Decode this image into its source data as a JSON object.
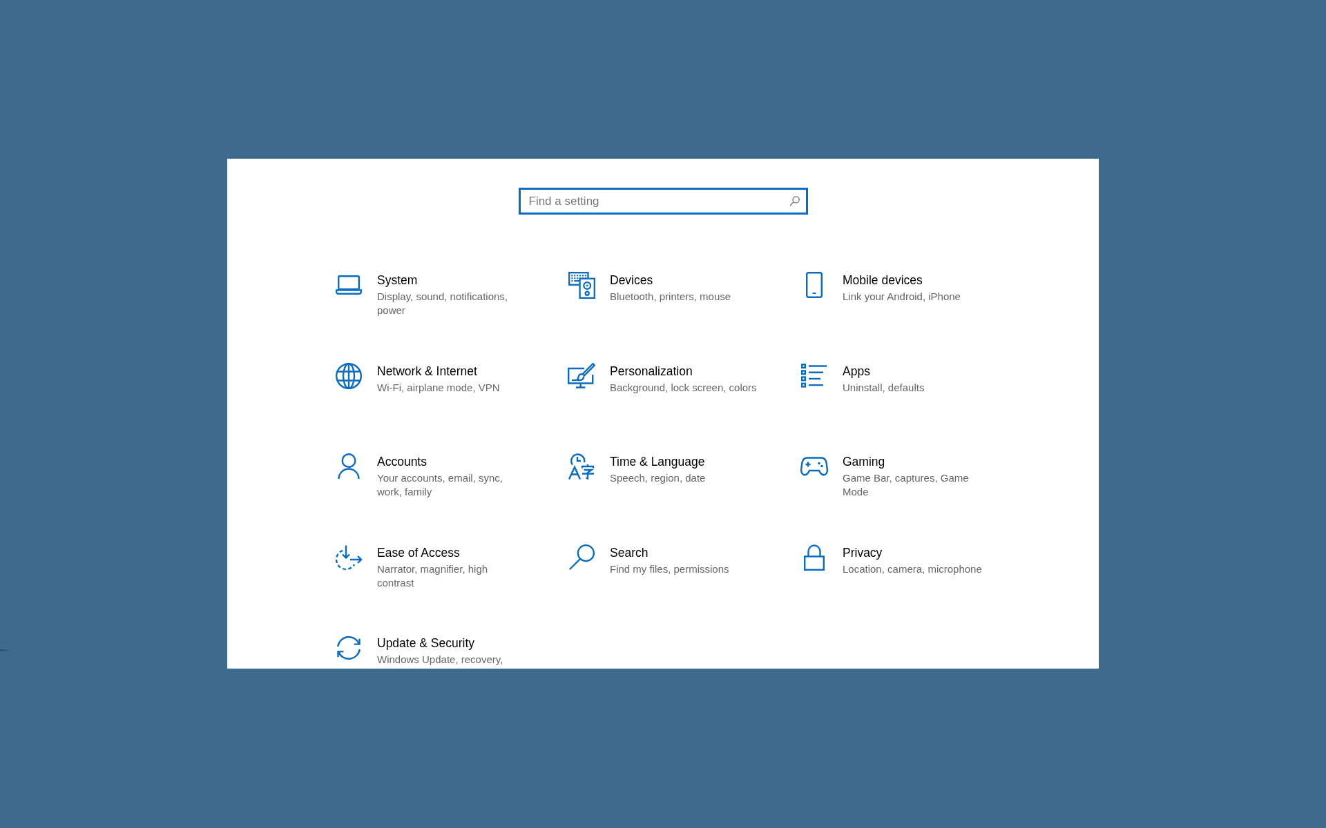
{
  "search": {
    "placeholder": "Find a setting"
  },
  "categories": [
    {
      "kind": "laptop",
      "title": "System",
      "description": "Display, sound, notifications, power"
    },
    {
      "kind": "devices",
      "title": "Devices",
      "description": "Bluetooth, printers, mouse"
    },
    {
      "kind": "phone",
      "title": "Mobile devices",
      "description": "Link your Android, iPhone"
    },
    {
      "kind": "globe",
      "title": "Network & Internet",
      "description": "Wi-Fi, airplane mode, VPN"
    },
    {
      "kind": "brush",
      "title": "Personalization",
      "description": "Background, lock screen, colors"
    },
    {
      "kind": "list",
      "title": "Apps",
      "description": "Uninstall, defaults"
    },
    {
      "kind": "person",
      "title": "Accounts",
      "description": "Your accounts, email, sync, work, family"
    },
    {
      "kind": "clock",
      "title": "Time & Language",
      "description": "Speech, region, date"
    },
    {
      "kind": "gamepad",
      "title": "Gaming",
      "description": "Game Bar, captures, Game Mode"
    },
    {
      "kind": "access",
      "title": "Ease of Access",
      "description": "Narrator, magnifier, high contrast"
    },
    {
      "kind": "magnifier",
      "title": "Search",
      "description": "Find my files, permissions"
    },
    {
      "kind": "lock",
      "title": "Privacy",
      "description": "Location, camera, microphone"
    },
    {
      "kind": "sync",
      "title": "Update & Security",
      "description": "Windows Update, recovery,"
    }
  ]
}
